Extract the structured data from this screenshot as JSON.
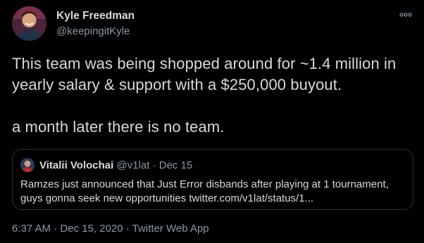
{
  "author": {
    "display_name": "Kyle Freedman",
    "handle": "@keepingitKyle"
  },
  "tweet": {
    "text": "This team was being shopped around for ~1.4 million in yearly salary & support with a $250,000 buyout.\n\na month later there is no team."
  },
  "quoted_tweet": {
    "display_name": "Vitalii Volochai",
    "handle": "@v1lat",
    "separator": " · ",
    "date": "Dec 15",
    "text": "Ramzes just announced that Just Error disbands after playing at 1 tournament, guys gonna seek new opportunities twitter.com/v1lat/status/1..."
  },
  "footer": {
    "time": "6:37 AM",
    "separator1": " · ",
    "date": "Dec 15, 2020",
    "separator2": " · ",
    "source": "Twitter Web App"
  },
  "icons": {
    "more": "more-horizontal-icon"
  },
  "colors": {
    "background": "#000000",
    "primary_text": "#d9d9d9",
    "secondary_text": "#8b98a5",
    "border": "#2f3336"
  }
}
